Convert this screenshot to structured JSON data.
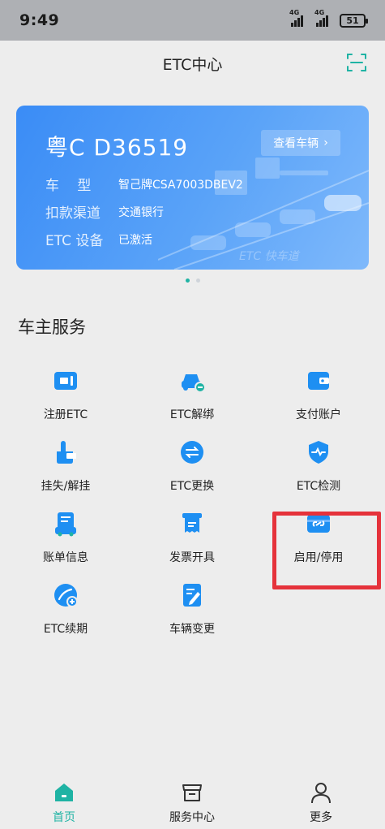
{
  "status": {
    "time": "9:49",
    "network1": "4G",
    "network2": "4G",
    "battery": "51"
  },
  "header": {
    "title": "ETC中心",
    "scan_icon": "scan-icon"
  },
  "banner": {
    "plate": "粤C D36519",
    "view_button": "查看车辆",
    "rows": [
      {
        "label": "车　 型",
        "value": "智己牌CSA7003DBEV2"
      },
      {
        "label": "扣款渠道",
        "value": "交通银行"
      },
      {
        "label": "ETC 设备",
        "value": "已激活"
      }
    ]
  },
  "carousel": {
    "count": 2,
    "active": 0
  },
  "section": {
    "title": "车主服务"
  },
  "services": [
    {
      "label": "注册ETC",
      "icon": "etc-card-icon"
    },
    {
      "label": "ETC解绑",
      "icon": "car-unbind-icon"
    },
    {
      "label": "支付账户",
      "icon": "wallet-icon"
    },
    {
      "label": "挂失/解挂",
      "icon": "report-loss-icon"
    },
    {
      "label": "ETC更换",
      "icon": "exchange-icon"
    },
    {
      "label": "ETC检测",
      "icon": "shield-check-icon"
    },
    {
      "label": "账单信息",
      "icon": "bill-icon"
    },
    {
      "label": "发票开具",
      "icon": "invoice-icon"
    },
    {
      "label": "启用/停用",
      "icon": "link-toggle-icon"
    },
    {
      "label": "ETC续期",
      "icon": "renew-icon"
    },
    {
      "label": "车辆变更",
      "icon": "vehicle-edit-icon"
    }
  ],
  "bottom_nav": [
    {
      "label": "首页",
      "icon": "home-icon",
      "active": true
    },
    {
      "label": "服务中心",
      "icon": "service-center-icon",
      "active": false
    },
    {
      "label": "更多",
      "icon": "user-icon",
      "active": false
    }
  ],
  "colors": {
    "accent": "#1fb3a4",
    "icon_blue": "#1e8ff2",
    "banner": "#3a8cf6",
    "highlight": "#e5323b"
  }
}
